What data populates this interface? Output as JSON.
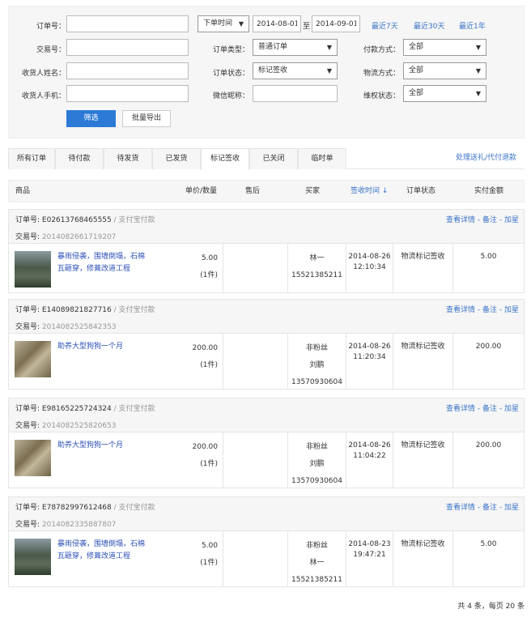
{
  "filter": {
    "order_no_label": "订单号：",
    "trade_no_label": "交易号：",
    "receiver_name_label": "收货人姓名：",
    "receiver_phone_label": "收货人手机：",
    "time_type": "下单时间",
    "date_from": "2014-08-01",
    "date_sep": "至",
    "date_to": "2014-09-01",
    "quick_7": "最近7天",
    "quick_30": "最近30天",
    "quick_1y": "最近1年",
    "order_type_label": "订单类型：",
    "order_type_value": "普通订单",
    "order_status_label": "订单状态：",
    "order_status_value": "标记签收",
    "wechat_label": "微信昵称：",
    "pay_method_label": "付款方式：",
    "pay_method_value": "全部",
    "logistics_label": "物流方式：",
    "logistics_value": "全部",
    "rights_label": "维权状态：",
    "rights_value": "全部",
    "filter_button": "筛选",
    "export_button": "批量导出"
  },
  "tabs": [
    "所有订单",
    "待付款",
    "待发货",
    "已发货",
    "标记签收",
    "已关闭",
    "临时单"
  ],
  "active_tab": 4,
  "tab_link": "处理送礼/代付退款",
  "columns": {
    "goods": "商品",
    "price_qty": "单价/数量",
    "aftersale": "售后",
    "buyer": "买家",
    "sign_time": "签收时间 ↓",
    "status": "订单状态",
    "amount": "实付金额"
  },
  "orders": [
    {
      "order_no_label": "订单号: ",
      "order_no": "E02613768465555",
      "pay": " / 支付宝付款",
      "trade_label": "交易号: ",
      "trade_no": "2014082661719207",
      "actions": "查看详情 - 备注 - 加星",
      "goods": "暴雨侵袭，围墙倒塌，石棉瓦砸穿，修葺改道工程",
      "price": "5.00",
      "qty": "(1件)",
      "buyer_tag": "",
      "buyer_name": "林一",
      "buyer_phone": "15521385211",
      "date": "2014-08-26",
      "time": "12:10:34",
      "status": "物流标记签收",
      "amount": "5.00"
    },
    {
      "order_no_label": "订单号: ",
      "order_no": "E14089821827716",
      "pay": " / 支付宝付款",
      "trade_label": "交易号: ",
      "trade_no": "2014082525842353",
      "actions": "查看详情 - 备注 - 加星",
      "goods": "助养大型狗狗一个月",
      "price": "200.00",
      "qty": "(1件)",
      "buyer_tag": "非粉丝",
      "buyer_name": "刘鹏",
      "buyer_phone": "13570930604",
      "date": "2014-08-26",
      "time": "11:20:34",
      "status": "物流标记签收",
      "amount": "200.00"
    },
    {
      "order_no_label": "订单号: ",
      "order_no": "E98165225724324",
      "pay": " / 支付宝付款",
      "trade_label": "交易号: ",
      "trade_no": "2014082525820653",
      "actions": "查看详情 - 备注 - 加星",
      "goods": "助养大型狗狗一个月",
      "price": "200.00",
      "qty": "(1件)",
      "buyer_tag": "非粉丝",
      "buyer_name": "刘鹏",
      "buyer_phone": "13570930604",
      "date": "2014-08-26",
      "time": "11:04:22",
      "status": "物流标记签收",
      "amount": "200.00"
    },
    {
      "order_no_label": "订单号: ",
      "order_no": "E78782997612468",
      "pay": " / 支付宝付款",
      "trade_label": "交易号: ",
      "trade_no": "2014082335887807",
      "actions": "查看详情 - 备注 - 加星",
      "goods": "暴雨侵袭，围墙倒塌，石棉瓦砸穿，修葺改道工程",
      "price": "5.00",
      "qty": "(1件)",
      "buyer_tag": "非粉丝",
      "buyer_name": "林一",
      "buyer_phone": "15521385211",
      "date": "2014-08-23",
      "time": "19:47:21",
      "status": "物流标记签收",
      "amount": "5.00"
    }
  ],
  "pagination": "共 4 条，每页 20 条"
}
